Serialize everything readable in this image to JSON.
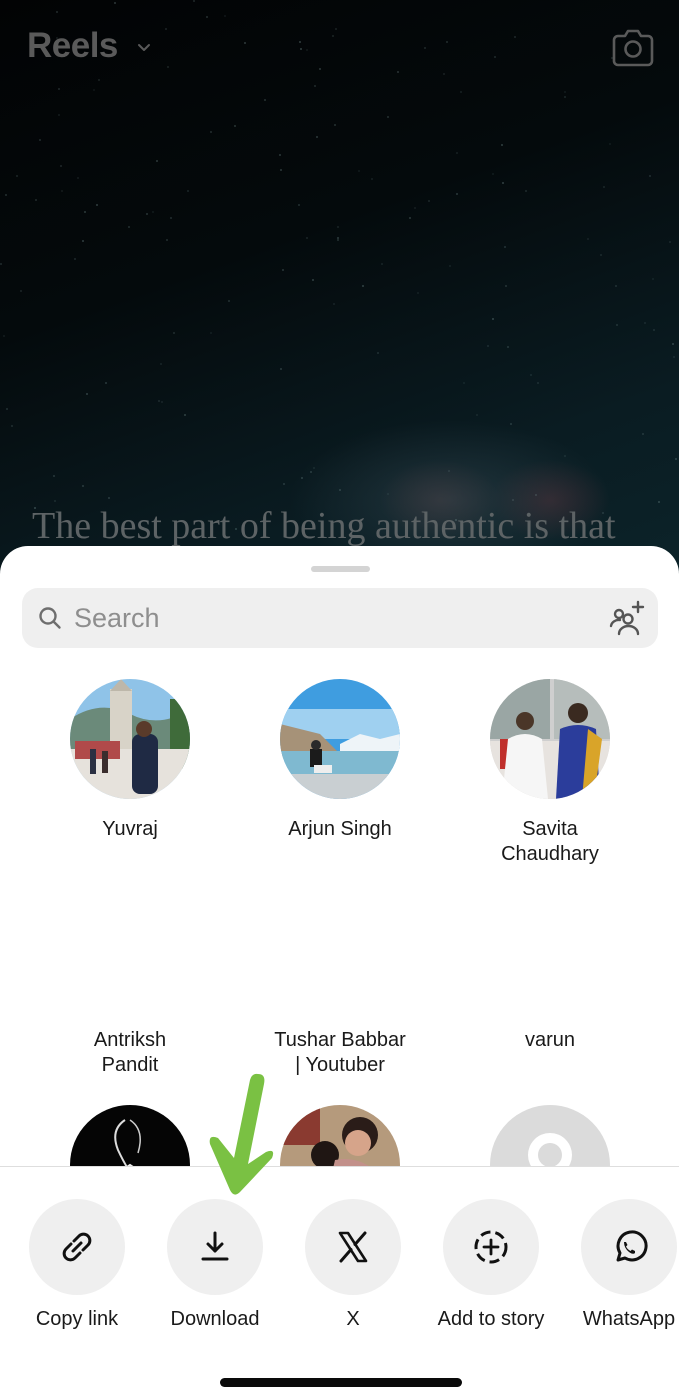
{
  "header": {
    "title": "Reels",
    "title_icon": "chevron-down-icon",
    "camera_icon": "camera-icon"
  },
  "video": {
    "caption": "The best part of being authentic is that"
  },
  "share_sheet": {
    "search": {
      "placeholder": "Search",
      "value": "",
      "icon": "search-icon",
      "add_people_icon": "add-people-icon"
    },
    "contacts": [
      {
        "name": "Yuvraj",
        "avatar": "photo"
      },
      {
        "name": "Arjun Singh",
        "avatar": "photo"
      },
      {
        "name": "Savita Chaudhary",
        "avatar": "photo"
      },
      {
        "name": "Antriksh Pandit",
        "avatar": "photo"
      },
      {
        "name": "Tushar Babbar | Youtuber",
        "avatar": "photo"
      },
      {
        "name": "varun",
        "avatar": "default"
      }
    ],
    "actions": [
      {
        "label": "Copy link",
        "icon": "link-icon"
      },
      {
        "label": "Download",
        "icon": "download-icon"
      },
      {
        "label": "X",
        "icon": "x-logo-icon"
      },
      {
        "label": "Add to story",
        "icon": "add-to-story-icon"
      },
      {
        "label": "WhatsApp",
        "icon": "whatsapp-icon"
      }
    ]
  },
  "annotation": {
    "arrow_color": "#7ac143",
    "points_to": "Download"
  }
}
